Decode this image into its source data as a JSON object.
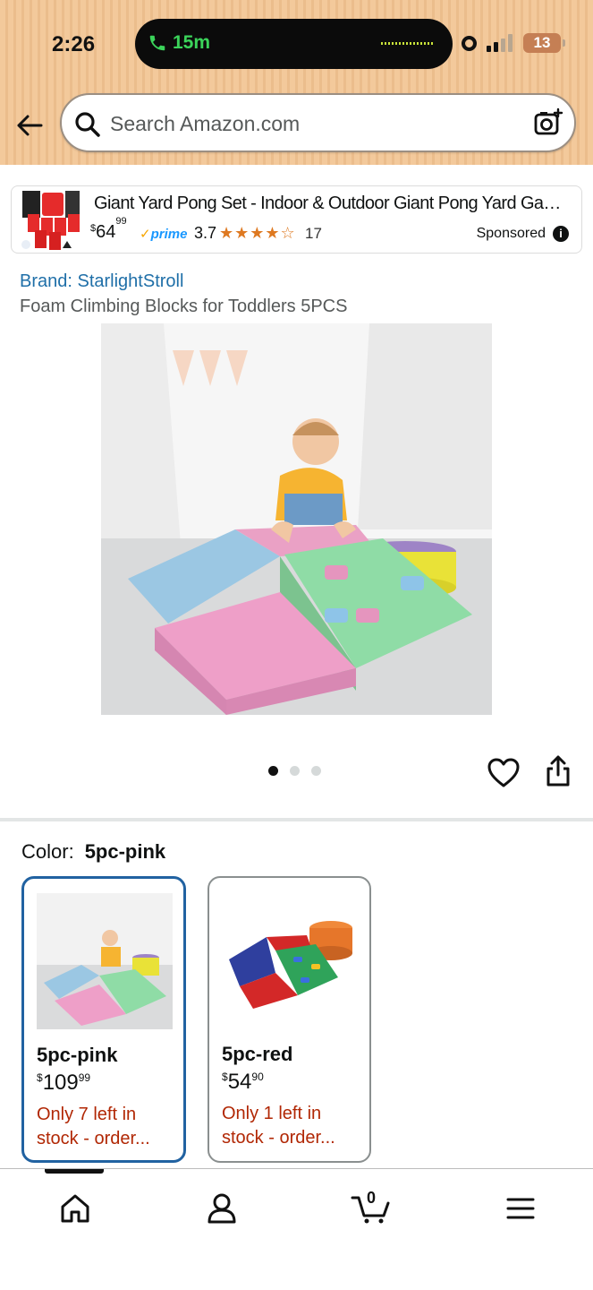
{
  "status_bar": {
    "time": "2:26",
    "call_duration": "15m",
    "battery": "13"
  },
  "search": {
    "placeholder": "Search Amazon.com"
  },
  "sponsored_ad": {
    "title": "Giant Yard Pong Set - Indoor & Outdoor Giant Pong Yard Game -...",
    "price_currency": "$",
    "price_whole": "64",
    "price_fraction": "99",
    "prime_label": "prime",
    "rating": "3.7",
    "stars_value": 3.7,
    "review_count": "17",
    "sponsored_label": "Sponsored"
  },
  "product": {
    "brand": "Brand: StarlightStroll",
    "title": "Foam Climbing Blocks for Toddlers 5PCS",
    "image_count": 3,
    "active_image_index": 0
  },
  "color_selector": {
    "label": "Color:",
    "selected": "5pc-pink",
    "options": [
      {
        "name": "5pc-pink",
        "currency": "$",
        "price_whole": "109",
        "price_fraction": "99",
        "stock": "Only 7 left in stock - order..."
      },
      {
        "name": "5pc-red",
        "currency": "$",
        "price_whole": "54",
        "price_fraction": "90",
        "stock": "Only 1 left in stock - order..."
      }
    ]
  },
  "bottom_nav": {
    "cart_count": "0",
    "items": [
      "home-icon",
      "account-icon",
      "cart-icon",
      "menu-icon"
    ]
  },
  "colors": {
    "header_bg": "#f3c99b",
    "link_blue": "#1f6fa8",
    "selected_border": "#2162a1",
    "stock_red": "#b12704",
    "star_orange": "#de7921"
  }
}
